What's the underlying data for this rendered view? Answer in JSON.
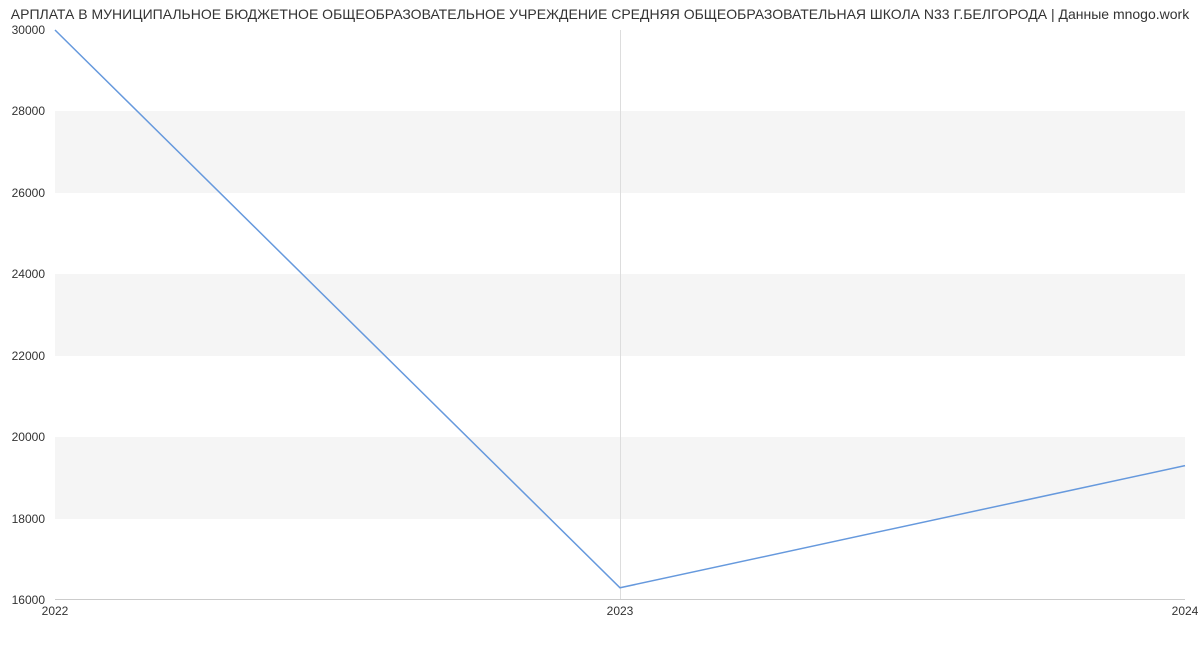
{
  "title": "АРПЛАТА В МУНИЦИПАЛЬНОЕ БЮДЖЕТНОЕ ОБЩЕОБРАЗОВАТЕЛЬНОЕ УЧРЕЖДЕНИЕ СРЕДНЯЯ ОБЩЕОБРАЗОВАТЕЛЬНАЯ ШКОЛА N33 Г.БЕЛГОРОДА | Данные mnogo.work",
  "chart_data": {
    "type": "line",
    "x": [
      "2022",
      "2023",
      "2024"
    ],
    "values": [
      30000,
      16300,
      19300
    ],
    "yticks": [
      16000,
      18000,
      20000,
      22000,
      24000,
      26000,
      28000,
      30000
    ],
    "ylim": [
      16000,
      30000
    ],
    "line_color": "#6699dd"
  }
}
